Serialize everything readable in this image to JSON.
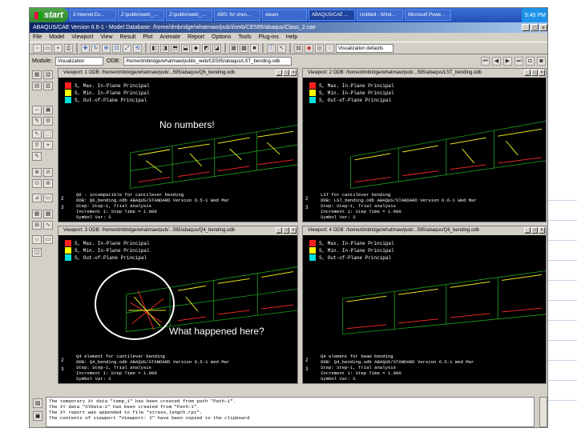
{
  "taskbar": {
    "start_label": "start",
    "tasks": [
      "3 Internet Ex...",
      "Z:\\public\\web\\_...",
      "Z:\\public\\web\\_...",
      "ABS: for shen...",
      "steam",
      "ABAQUS/CAE ...",
      "Untitled - Wind...",
      "Microsoft Powe..."
    ],
    "tray_time": "5:45 PM"
  },
  "window": {
    "title": "ABAQUS/CAE Version 6.6-1 - Model Database: /home/dmbridge/whatmaw/pub/i/smb/CE595/abaqus/Class_2.cae"
  },
  "menu": [
    "File",
    "Model",
    "Viewport",
    "View",
    "Result",
    "Plot",
    "Animate",
    "Report",
    "Options",
    "Tools",
    "Plug-ins",
    "Help"
  ],
  "toolbar": {
    "render_style": "Visualization defaults"
  },
  "context": {
    "module_label": "Module:",
    "module_value": "Visualization",
    "odb_label": "ODB:",
    "odb_value": "/home/dmbridge/whatmaw/public_web/CE595/abaqus/LST_bending.odb"
  },
  "legend": [
    {
      "label": "S, Max. In-Plane Principal",
      "color": "#ff2020"
    },
    {
      "label": "S, Min. In-Plane Principal",
      "color": "#ffff00"
    },
    {
      "label": "S, Out-of-Plane Principal",
      "color": "#00e0e0"
    }
  ],
  "viewports": [
    {
      "title": "Viewport: 1    ODB: /home/dmbridge/whatmaw/pub/...595/abaqus/Q6_bending.odb",
      "info": [
        "Q6 - incompatible for cantilever bending",
        "ODB: Q6_bending.odb    ABAQUS/STANDARD Version 6.5-1    Wed Mar",
        "Step: Step-1, Trial analysis",
        "Increment    1: Step Time =    1.000",
        "Symbol Var: S"
      ]
    },
    {
      "title": "Viewport: 2    ODB: /home/dmbridge/whatmaw/pub/...595/abaqus/LST_bending.odb",
      "info": [
        "LST for cantilever bending",
        "ODB: LST_bending.odb    ABAQUS/STANDARD Version 6.6-1    Wed Mar",
        "Step: Step-1, Trial analysis",
        "Increment    1: Step Time =    1.000",
        "Symbol Var: S"
      ]
    },
    {
      "title": "Viewport: 3    ODB: /home/dmbridge/whatmaw/pub/...595/abaqus/Q4_bending.odb",
      "info": [
        "Q4 element for cantilever bending",
        "ODB: Q4_bending.odb    ABAQUS/STANDARD Version 6.5-1    Wed Mar",
        "Step: Step-1, Trial analysis",
        "Increment    1: Step Time =    1.000",
        "Symbol Var: S"
      ]
    },
    {
      "title": "Viewport: 4    ODB: /home/dmbridge/whatmaw/pub/...595/abaqus/Q6_bending.odb",
      "info": [
        "Q4 element for beam bending",
        "ODB: Q4_bending.odb    ABAQUS/STANDARD Version 6.5-1    Wed Mar",
        "Step: Step-1, Trial analysis",
        "Increment    1: Step Time =    1.000",
        "Symbol Var: S"
      ]
    }
  ],
  "triad": [
    "2",
    "3",
    "1"
  ],
  "messages": [
    "The temporary XY data \"temp_1\" has been created from path \"Path-1\".",
    "The XY data \"XYData-1\" has been created from \"Path-1\".",
    "The XY report was appended to file \"stress_length.rpt\".",
    "The contents of viewport \"Viewport: 2\" have been copied to the clipboard"
  ],
  "annotations": {
    "no_numbers": "No numbers!",
    "what_happened": "What happened here?"
  }
}
